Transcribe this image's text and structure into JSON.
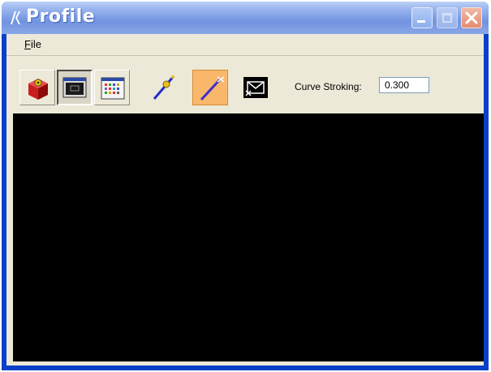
{
  "window": {
    "title": "Profile",
    "controls": [
      "minimize",
      "maximize",
      "close"
    ]
  },
  "menu": {
    "items": [
      {
        "label": "File"
      }
    ]
  },
  "toolbar": {
    "tools": [
      {
        "name": "red-cube-icon",
        "state": "raised"
      },
      {
        "name": "monitor-icon",
        "state": "pressed"
      },
      {
        "name": "calendar-grid-icon",
        "state": "raised"
      },
      {
        "name": "line-points-icon",
        "state": "flat"
      },
      {
        "name": "active-line-icon",
        "state": "active"
      },
      {
        "name": "envelope-icon",
        "state": "flat"
      }
    ],
    "curve_stroking": {
      "label": "Curve Stroking:",
      "value": "0.300"
    }
  },
  "colors": {
    "title_bar": "#7f9fe6",
    "canvas": "#000000",
    "active_tool": "#f9b76b"
  }
}
